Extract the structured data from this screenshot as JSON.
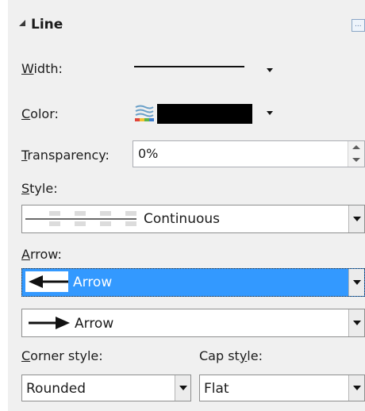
{
  "section": {
    "title": "Line"
  },
  "width": {
    "label": "Width:"
  },
  "color": {
    "label": "Color:",
    "swatch": "#000000"
  },
  "transparency": {
    "label": "Transparency:",
    "value": "0%"
  },
  "style": {
    "label": "Style:",
    "value": "Continuous"
  },
  "arrow": {
    "label": "Arrow:",
    "start": {
      "value": "Arrow",
      "selected": true
    },
    "end": {
      "value": "Arrow"
    }
  },
  "corner_style": {
    "label": "Corner style:",
    "value": "Rounded"
  },
  "cap_style": {
    "label": "Cap style:",
    "value": "Flat"
  },
  "colors": {
    "selection": "#3399ff",
    "panel": "#f0f0f0"
  }
}
